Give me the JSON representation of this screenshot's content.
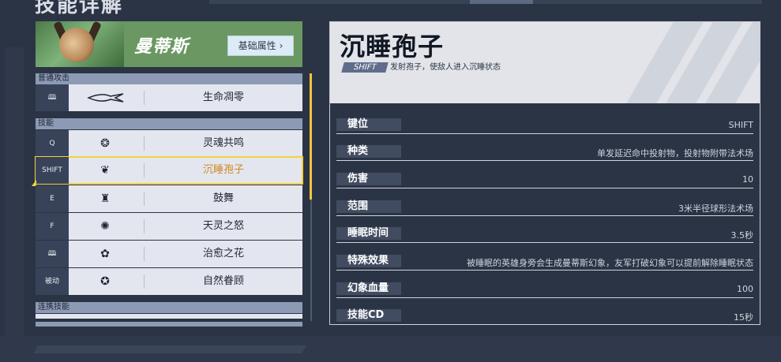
{
  "page": {
    "top_title": "技能详解"
  },
  "hero": {
    "name": "曼蒂斯",
    "attributes_button": "基础属性",
    "chevron": "›"
  },
  "left": {
    "section_basic": "普通攻击",
    "section_skills": "技能",
    "section_combo": "连携技能",
    "basic_row": {
      "key": "🕮",
      "icon": "blade-icon",
      "name": "生命凋零"
    },
    "skills": [
      {
        "key": "Q",
        "icon": "soul-icon",
        "name": "灵魂共鸣",
        "active": false
      },
      {
        "key": "SHIFT",
        "icon": "spore-icon",
        "name": "沉睡孢子",
        "active": true
      },
      {
        "key": "E",
        "icon": "dance-icon",
        "name": "鼓舞",
        "active": false
      },
      {
        "key": "F",
        "icon": "wrath-icon",
        "name": "天灵之怒",
        "active": false
      },
      {
        "key": "🕮",
        "icon": "flower-icon",
        "name": "治愈之花",
        "active": false
      },
      {
        "key": "被动",
        "icon": "nature-icon",
        "name": "自然眷顾",
        "active": false
      }
    ]
  },
  "detail": {
    "title": "沉睡孢子",
    "key": "SHIFT",
    "description": "发射孢子，使敌人进入沉睡状态",
    "attributes": [
      {
        "label": "键位",
        "value": "SHIFT"
      },
      {
        "label": "种类",
        "value": "单发延迟命中投射物，投射物附带法术场"
      },
      {
        "label": "伤害",
        "value": "10"
      },
      {
        "label": "范围",
        "value": "3米半径球形法术场"
      },
      {
        "label": "睡眠时间",
        "value": "3.5秒"
      },
      {
        "label": "特殊效果",
        "value": "被睡眠的英雄身旁会生成曼蒂斯幻象，友军打破幻象可以提前解除睡眠状态"
      },
      {
        "label": "幻象血量",
        "value": "100"
      },
      {
        "label": "技能CD",
        "value": "15秒"
      }
    ]
  },
  "colors": {
    "accent": "#f5d23c",
    "active_text": "#d28a24",
    "hero_header": "#6b9862"
  }
}
